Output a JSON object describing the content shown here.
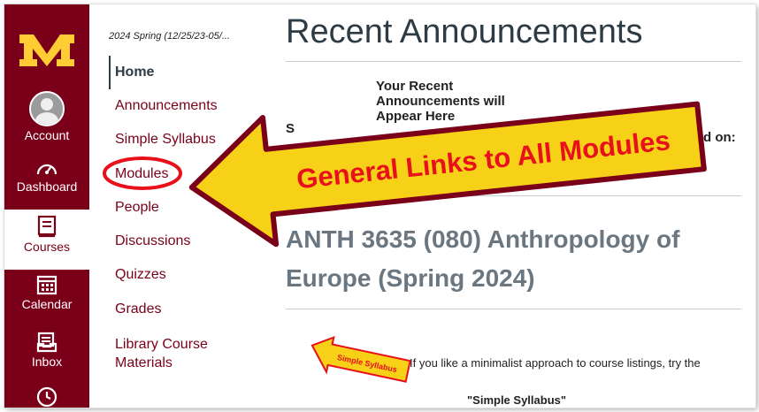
{
  "global_nav": {
    "account_label": "Account",
    "dashboard_label": "Dashboard",
    "courses_label": "Courses",
    "calendar_label": "Calendar",
    "inbox_label": "Inbox"
  },
  "course_nav": {
    "term": "2024 Spring (12/25/23-05/...",
    "items": [
      "Home",
      "Announcements",
      "Simple Syllabus",
      "Modules",
      "People",
      "Discussions",
      "Quizzes",
      "Grades",
      "Library Course Materials"
    ]
  },
  "main": {
    "heading": "Recent Announcements",
    "recent_text": "Your Recent Announcements will Appear Here",
    "stub_left": "S",
    "stub_right": "d on:",
    "course_title": "ANTH 3635 (080) Anthropology of Europe (Spring 2024)",
    "minimalist_text": "If you like a minimalist approach to course listings, try the",
    "simple_syllabus_quote": "\"Simple Syllabus\""
  },
  "annotations": {
    "big_arrow_text": "General Links to All Modules",
    "small_arrow_text": "Simple Syllabus",
    "arrow_fill": "#f7d117",
    "arrow_border": "#7a0019",
    "arrow_text_color": "#e8101a",
    "circle_color": "#e8101a"
  },
  "colors": {
    "maroon": "#7a0019",
    "gold": "#ffcc33"
  },
  "icons": [
    "umn-logo-icon",
    "account-avatar-icon",
    "dashboard-icon",
    "courses-icon",
    "calendar-icon",
    "inbox-icon",
    "history-clock-icon"
  ]
}
